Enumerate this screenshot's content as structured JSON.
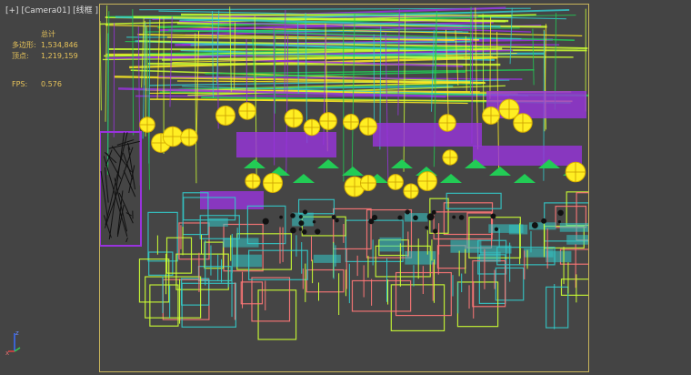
{
  "viewport": {
    "plus_label": "[+]",
    "camera_label": "[Camera01]",
    "mode_label": "[线框 ]"
  },
  "stats": {
    "header": "总计",
    "polygons_label": "多边形:",
    "polygons_value": "1,534,846",
    "vertices_label": "顶点:",
    "vertices_value": "1,219,159",
    "fps_label": "FPS:",
    "fps_value": "0.576"
  },
  "axis_gizmo": {
    "x": "x",
    "z": "z"
  },
  "colors": {
    "background": "#444444",
    "safe_frame": "#c8b45a",
    "stats_text": "#e7c35a",
    "wire_yellow": "#ffee22",
    "wire_green": "#22cc55",
    "wire_purple": "#9933dd",
    "wire_cyan": "#33c8c8",
    "wire_salmon": "#ff7777",
    "wire_lime": "#ccff33"
  }
}
